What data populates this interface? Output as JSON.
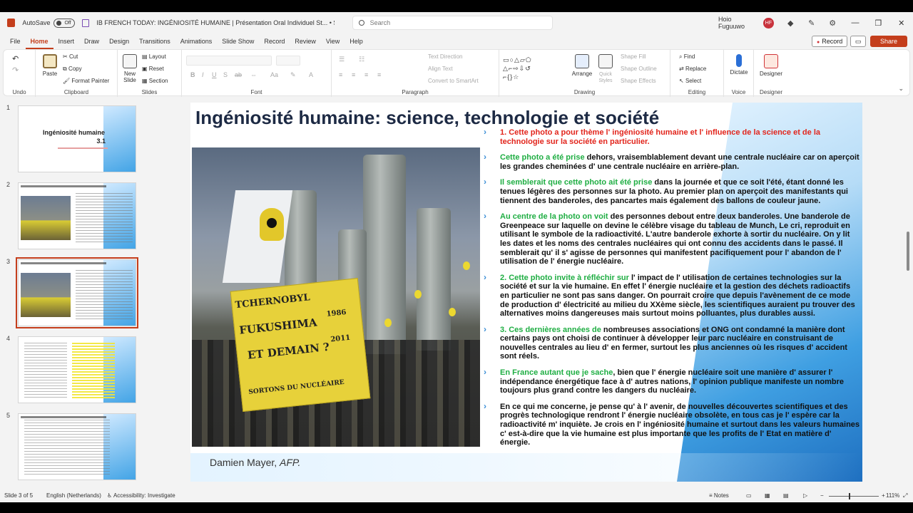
{
  "app": {
    "autosave_label": "AutoSave",
    "autosave_state": "Off",
    "document_title": "IB FRENCH TODAY: INGÉNIOSITÉ HUMAINE | Présentation Oral Individuel St... • Saved to this PC",
    "search_placeholder": "Search",
    "user_name": "Hoio Fuguuwo",
    "user_initials": "HF"
  },
  "menu": {
    "tabs": [
      "File",
      "Home",
      "Insert",
      "Draw",
      "Design",
      "Transitions",
      "Animations",
      "Slide Show",
      "Record",
      "Review",
      "View",
      "Help"
    ],
    "active": "Home",
    "record_label": "Record",
    "share_label": "Share"
  },
  "ribbon": {
    "undo_label": "Undo",
    "clipboard": {
      "paste": "Paste",
      "cut": "Cut",
      "copy": "Copy",
      "format_painter": "Format Painter",
      "label": "Clipboard"
    },
    "slides": {
      "new_slide": "New Slide",
      "layout": "Layout",
      "reset": "Reset",
      "section": "Section",
      "label": "Slides"
    },
    "font": {
      "label": "Font"
    },
    "paragraph": {
      "text_direction": "Text Direction",
      "align_text": "Align Text",
      "convert_smartart": "Convert to SmartArt",
      "label": "Paragraph"
    },
    "drawing": {
      "arrange": "Arrange",
      "quick_styles": "Quick Styles",
      "shape_fill": "Shape Fill",
      "shape_outline": "Shape Outline",
      "shape_effects": "Shape Effects",
      "label": "Drawing"
    },
    "editing": {
      "find": "Find",
      "replace": "Replace",
      "select": "Select",
      "label": "Editing"
    },
    "voice": {
      "dictate": "Dictate",
      "label": "Voice"
    },
    "designer": {
      "designer": "Designer",
      "label": "Designer"
    }
  },
  "thumbnails": [
    {
      "num": "1",
      "title": "Ingéniosité humaine",
      "subtitle": "3.1"
    },
    {
      "num": "2"
    },
    {
      "num": "3"
    },
    {
      "num": "4"
    },
    {
      "num": "5"
    }
  ],
  "slide": {
    "title": "Ingéniosité humaine: science, technologie et société",
    "photo_credit_name": "Damien Mayer,",
    "photo_credit_agency": "AFP.",
    "banner_lines": [
      "TCHERNOBYL",
      "FUKUSHIMA",
      "ET DEMAIN ?",
      "SORTONS DU NUCLÉAIRE"
    ],
    "banner_years": [
      "1986",
      "2011"
    ],
    "paragraphs": [
      {
        "lead": "1. Cette photo a pour thème l' ingéniosité humaine et l' influence de la science et de la technologie sur la société en particulier.",
        "lead_color": "red",
        "rest": ""
      },
      {
        "lead": "Cette photo a été prise",
        "lead_color": "green",
        "rest": " dehors, vraisemblablement devant une centrale nucléaire car on aperçoit les grandes cheminées d' une centrale nucléaire en arrière-plan."
      },
      {
        "lead": "Il semblerait que cette photo ait été prise",
        "lead_color": "green",
        "rest": " dans la journée et que ce soit l'été, étant donné les tenues légères des personnes sur la photo. Au premier plan on aperçoit des manifestants qui tiennent des banderoles, des pancartes mais également des ballons de couleur jaune."
      },
      {
        "lead": "Au centre de la photo on voit",
        "lead_color": "green",
        "rest": " des personnes debout entre deux banderoles. Une banderole de Greenpeace sur laquelle on devine le célèbre visage du tableau de Munch, Le cri, reproduit en utilisant le symbole de la radioactivité.  L'autre banderole exhorte à sortir du nucléaire. On y lit les dates et les noms des centrales nucléaires qui ont connu des accidents dans le passé. Il semblerait qu' il s' agisse de personnes qui manifestent pacifiquement pour l' abandon de l' utilisation de l' énergie nucléaire."
      },
      {
        "lead": "2. Cette photo invite à réfléchir sur",
        "lead_color": "green",
        "rest": " l' impact de l' utilisation de certaines technologies sur la société et sur la vie humaine. En effet l' énergie nucléaire et la gestion des déchets radioactifs en particulier ne sont pas sans danger. On pourrait croire que depuis l'avènement de ce mode de production d' électricité au milieu du XXème siècle, les scientifiques auraient pu trouver des alternatives moins dangereuses mais surtout moins polluantes, plus durables aussi."
      },
      {
        "lead": "3. Ces dernières années de",
        "lead_color": "green",
        "rest": " nombreuses associations et ONG ont condamné la manière dont certains pays ont choisi de continuer à développer leur parc nucléaire en construisant de nouvelles centrales au lieu d' en fermer, surtout les plus anciennes où les risques d' accident sont réels."
      },
      {
        "lead": "En France autant que je sache",
        "lead_color": "green",
        "rest": ", bien que l' énergie nucléaire soit une manière d' assurer l' indépendance énergétique face à d' autres nations, l' opinion publique manifeste un nombre toujours plus grand contre les dangers du nucléaire."
      },
      {
        "lead": "",
        "lead_color": "",
        "rest": "En ce qui me concerne, je pense qu' à l' avenir, de nouvelles découvertes scientifiques et des progrès technologique rendront l' énergie nucléaire obsolète, en tous cas je l' espère car la radioactivité m' inquiète. Je crois en l' ingéniosité humaine et surtout dans les valeurs humaines c' est-à-dire que la vie humaine est plus importante que les profits de l' Etat en matière d' énergie."
      }
    ]
  },
  "status": {
    "slide_of": "Slide 3 of 5",
    "language": "English (Netherlands)",
    "accessibility": "Accessibility: Investigate",
    "notes": "Notes",
    "zoom": "111%"
  },
  "colors": {
    "accent": "#c43e1c",
    "lead_red": "#e2251c",
    "lead_green": "#1fae43"
  }
}
